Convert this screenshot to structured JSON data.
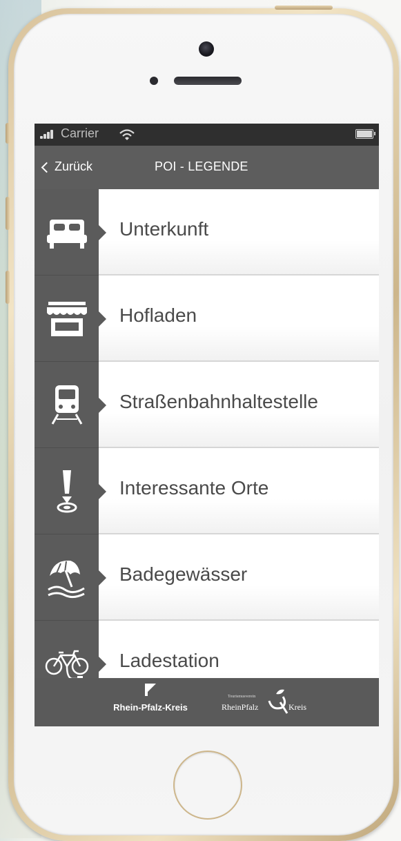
{
  "status_bar": {
    "carrier": "Carrier"
  },
  "nav_bar": {
    "back_label": "Zurück",
    "title": "POI - LEGENDE"
  },
  "legend_items": [
    {
      "label": "Unterkunft",
      "icon": "bed-icon"
    },
    {
      "label": "Hofladen",
      "icon": "farm-shop-icon"
    },
    {
      "label": "Straßenbahnhaltestelle",
      "icon": "tram-icon"
    },
    {
      "label": "Interessante Orte",
      "icon": "point-of-interest-icon"
    },
    {
      "label": "Badegewässer",
      "icon": "beach-umbrella-icon"
    },
    {
      "label": "Ladestation",
      "icon": "ebike-charging-icon"
    }
  ],
  "footer": {
    "logo_left": "Rhein-Pfalz-Kreis",
    "logo_right_small": "Tourismusverein",
    "logo_right_part1": "RheinPfalz",
    "logo_right_part2": "Kreis"
  },
  "colors": {
    "icon_column": "#5b5b5b",
    "nav_bar": "#5d5d5d",
    "status_bar": "#2f2f2f",
    "row_text": "#4a4a4a",
    "phone_gold": "#d8c29b"
  }
}
